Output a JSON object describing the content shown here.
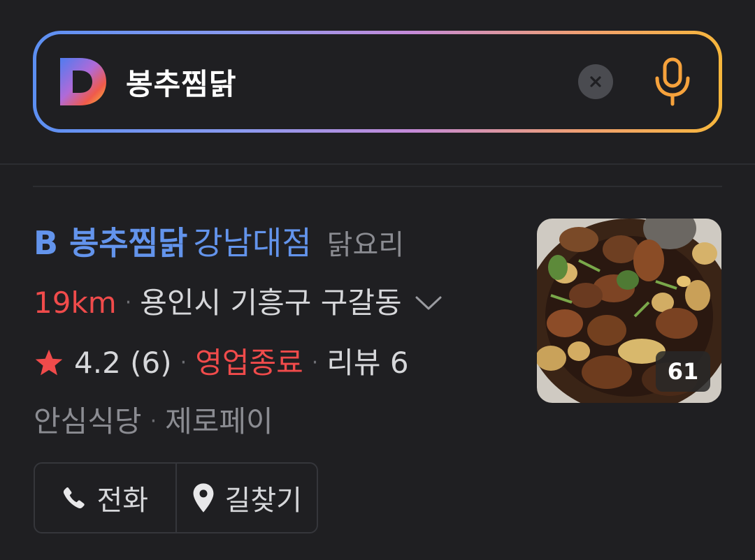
{
  "search": {
    "query": "봉추찜닭",
    "logo_letter": "D",
    "clear_icon": "close-icon",
    "mic_icon": "microphone-icon"
  },
  "result": {
    "name": "B 봉추찜닭",
    "branch": "강남대점",
    "category": "닭요리",
    "distance": "19km",
    "address": "용인시 기흥구 구갈동",
    "rating": "4.2 (6)",
    "status": "영업종료",
    "reviews": "리뷰 6",
    "tag1": "안심식당",
    "tag2": "제로페이",
    "photo_count": "61",
    "actions": {
      "call": "전화",
      "directions": "길찾기"
    }
  },
  "colors": {
    "accent_blue": "#6394ec",
    "alert_red": "#f04b4b",
    "mic_orange": "#f6a23c"
  }
}
